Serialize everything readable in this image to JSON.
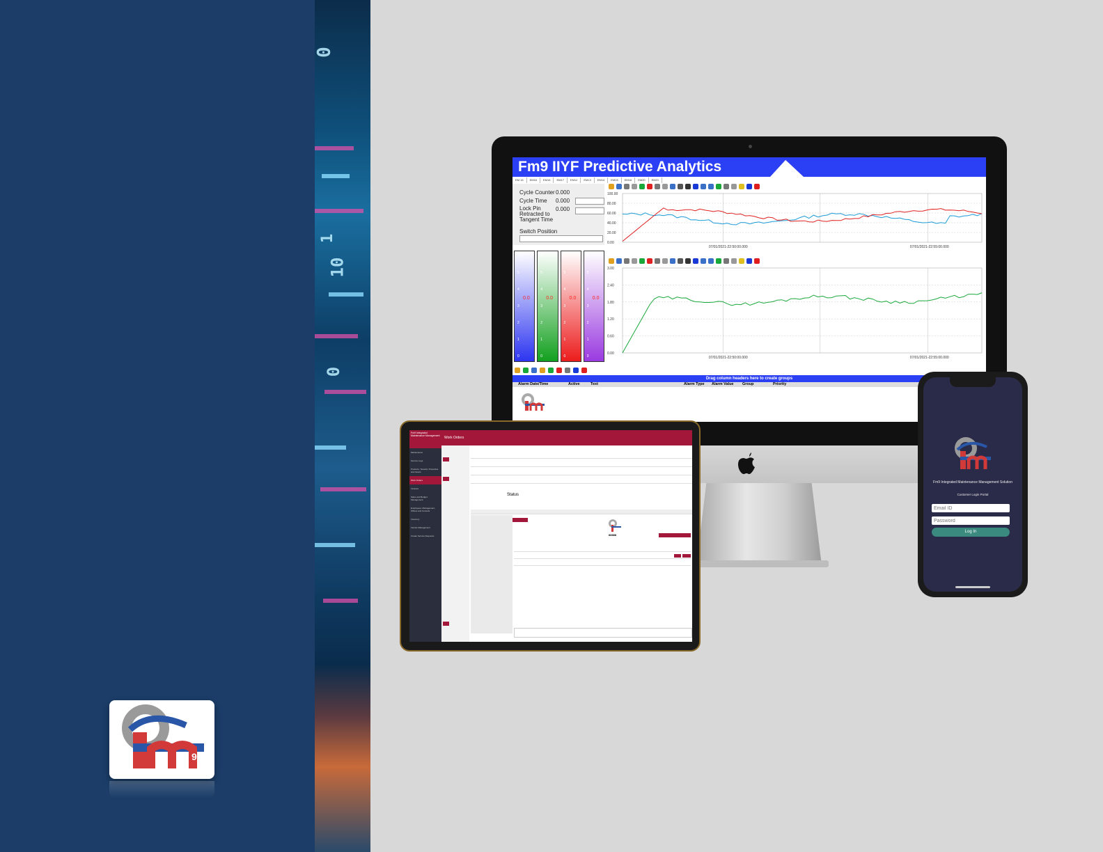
{
  "monitor_app": {
    "title": "Fm9 IIYF Predictive Analytics",
    "tabs": [
      "EM 15",
      "EM16",
      "EM16",
      "EM17",
      "EM12",
      "EM13",
      "EM14",
      "EM15",
      "EM16",
      "EM20",
      "EM21"
    ],
    "form": {
      "cycle_counter_label": "Cycle Counter",
      "cycle_counter_value": "0.000",
      "cycle_time_label": "Cycle Time",
      "cycle_time_value": "0.000",
      "lock_pin_label": "Lock Pin Retracted to Tangent Time",
      "lock_pin_value": "0.000",
      "switch_position_label": "Switch Position"
    },
    "gauge_value": "0.0",
    "gauge_ticks": [
      "6",
      "5",
      "4",
      "3",
      "2",
      "1",
      "0"
    ],
    "chart_top": {
      "yticks": [
        "100.00",
        "80.00",
        "60.00",
        "40.00",
        "20.00",
        "0.00"
      ],
      "xticks": [
        "07/01/2021-22:50:00.000",
        "07/01/2021-22:55:00.000"
      ],
      "colors": {
        "red": "#e02020",
        "blue": "#1a9ad8"
      }
    },
    "chart_bottom": {
      "yticks": [
        "3.00",
        "2.40",
        "1.80",
        "1.20",
        "0.60",
        "0.00"
      ],
      "xticks": [
        "07/01/2021-22:50:00.000",
        "07/01/2021-22:55:00.000"
      ],
      "colors": {
        "green": "#1aa83a"
      }
    },
    "group_banner": "Drag column headers here to create groups",
    "columns": [
      "Alarm Date/Time",
      "Active",
      "Text",
      "Alarm Type",
      "Alarm Value",
      "Group",
      "Priority"
    ]
  },
  "tablet_app": {
    "brand": "Fm9 Integrated Maintenance Management",
    "header": "Work Orders",
    "sidebar": [
      "Maintenance",
      "Service Logs",
      "Products, Tenants, Properties and Assets",
      "Work Orders",
      "Invoices",
      "Sales and Budget Management",
      "Employees, Management, Offices and Controls",
      "Inventory",
      "Vendor Management",
      "Create Service Requests"
    ],
    "active_index": 3,
    "status_label": "Status",
    "ticket_number": "88888"
  },
  "phone_app": {
    "title": "Fm9 Integrated Maintenance Management Solution",
    "subtitle": "Customer Login Portal",
    "email_placeholder": "Email ID",
    "password_placeholder": "Password",
    "login_label": "Log In"
  },
  "colors": {
    "brand_blue": "#2b3ff5",
    "navy_panel": "#1b3d68",
    "crimson": "#a3173a",
    "teal_button": "#3a8a80"
  }
}
